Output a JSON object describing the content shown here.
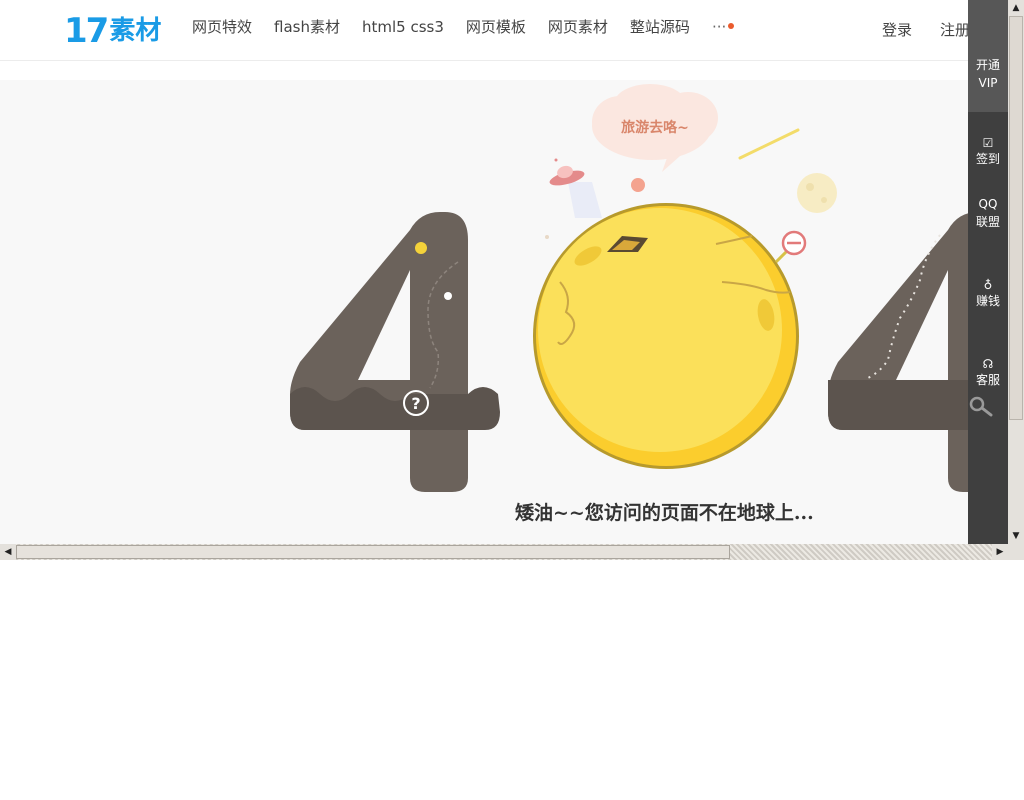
{
  "logo": {
    "number": "17",
    "text": "素材"
  },
  "nav": {
    "items": [
      {
        "label": "网页特效"
      },
      {
        "label": "flash素材"
      },
      {
        "label": "html5 css3"
      },
      {
        "label": "网页模板"
      },
      {
        "label": "网页素材"
      },
      {
        "label": "整站源码"
      }
    ],
    "more": "···"
  },
  "auth": {
    "login": "登录",
    "register": "注册"
  },
  "error": {
    "cloud": "旅游去咯~",
    "message": "矮油~~您访问的页面不在地球上..."
  },
  "sidebar": {
    "vip_line1": "开通",
    "vip_line2": "VIP",
    "checkin": "签到",
    "qq_line1": "QQ",
    "qq_line2": "联盟",
    "earn": "赚钱",
    "service": "客服"
  },
  "colors": {
    "brand": "#1a9be6",
    "digit": "#6b625b",
    "planet": "#fbe05a",
    "accent_dot": "#ea5b2d"
  }
}
